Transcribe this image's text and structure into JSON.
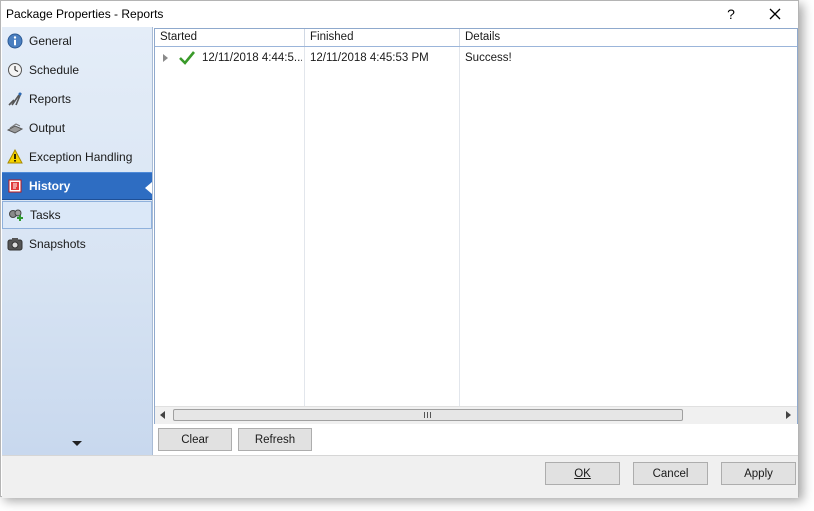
{
  "window": {
    "title": "Package Properties - Reports",
    "help_label": "?",
    "close_label": "✕"
  },
  "sidebar": {
    "items": [
      {
        "label": "General",
        "icon": "info-icon"
      },
      {
        "label": "Schedule",
        "icon": "clock-icon"
      },
      {
        "label": "Reports",
        "icon": "reports-icon"
      },
      {
        "label": "Output",
        "icon": "output-icon"
      },
      {
        "label": "Exception Handling",
        "icon": "warning-icon"
      },
      {
        "label": "History",
        "icon": "history-icon",
        "active": true
      },
      {
        "label": "Tasks",
        "icon": "tasks-icon",
        "hover": true
      },
      {
        "label": "Snapshots",
        "icon": "camera-icon"
      }
    ]
  },
  "history_grid": {
    "columns": [
      "Started",
      "Finished",
      "Details"
    ],
    "rows": [
      {
        "started": "12/11/2018 4:44:5...",
        "finished": "12/11/2018 4:45:53 PM",
        "details": "Success!",
        "status_icon": "check-icon"
      }
    ]
  },
  "actions": {
    "clear_label": "Clear",
    "refresh_label": "Refresh"
  },
  "footer": {
    "ok_label": "OK",
    "cancel_label": "Cancel",
    "apply_label": "Apply"
  },
  "colors": {
    "active_nav": "#2e6dc2",
    "sidebar_bg": "#d8e4f3",
    "success_check": "#3a9a2a"
  }
}
